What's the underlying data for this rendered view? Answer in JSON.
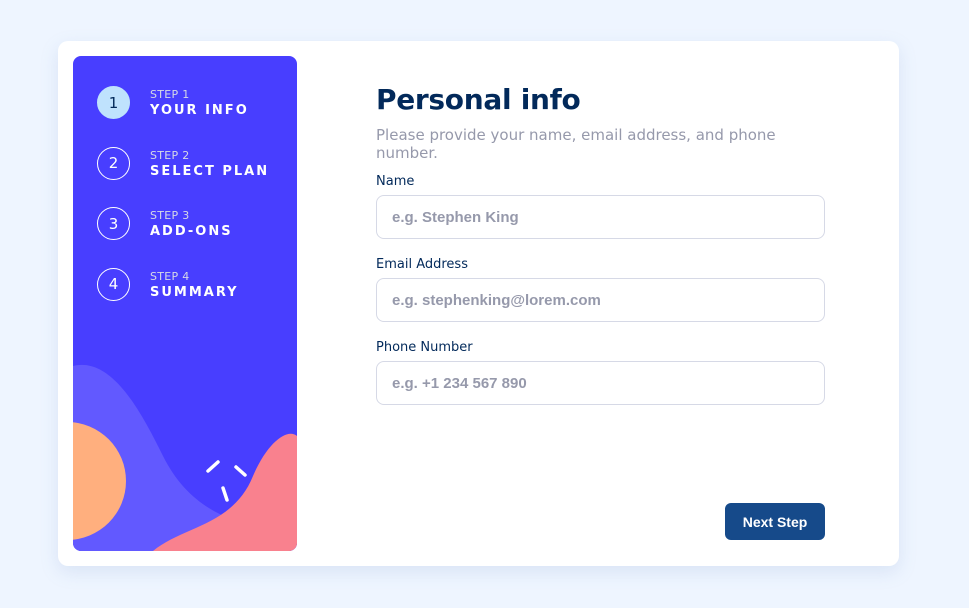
{
  "sidebar": {
    "steps": [
      {
        "number": "1",
        "label": "STEP 1",
        "title": "YOUR INFO"
      },
      {
        "number": "2",
        "label": "STEP 2",
        "title": "SELECT PLAN"
      },
      {
        "number": "3",
        "label": "STEP 3",
        "title": "ADD-ONS"
      },
      {
        "number": "4",
        "label": "STEP 4",
        "title": "SUMMARY"
      }
    ],
    "active_step": 1
  },
  "main": {
    "title": "Personal info",
    "subtitle": "Please provide your name, email address, and phone number.",
    "fields": [
      {
        "label": "Name",
        "placeholder": "e.g. Stephen King",
        "value": ""
      },
      {
        "label": "Email Address",
        "placeholder": "e.g. stephenking@lorem.com",
        "value": ""
      },
      {
        "label": "Phone Number",
        "placeholder": "e.g. +1 234 567 890",
        "value": ""
      }
    ],
    "next_button_label": "Next Step"
  },
  "colors": {
    "page_background": "#eef5ff",
    "sidebar_background": "#483eff",
    "active_step_fill": "#bfe2fd",
    "marine_blue": "#02295a",
    "button_background": "#164a8a",
    "blob_purple": "#6259ff",
    "blob_orange": "#ffaf7e",
    "blob_pink": "#f9818e"
  }
}
